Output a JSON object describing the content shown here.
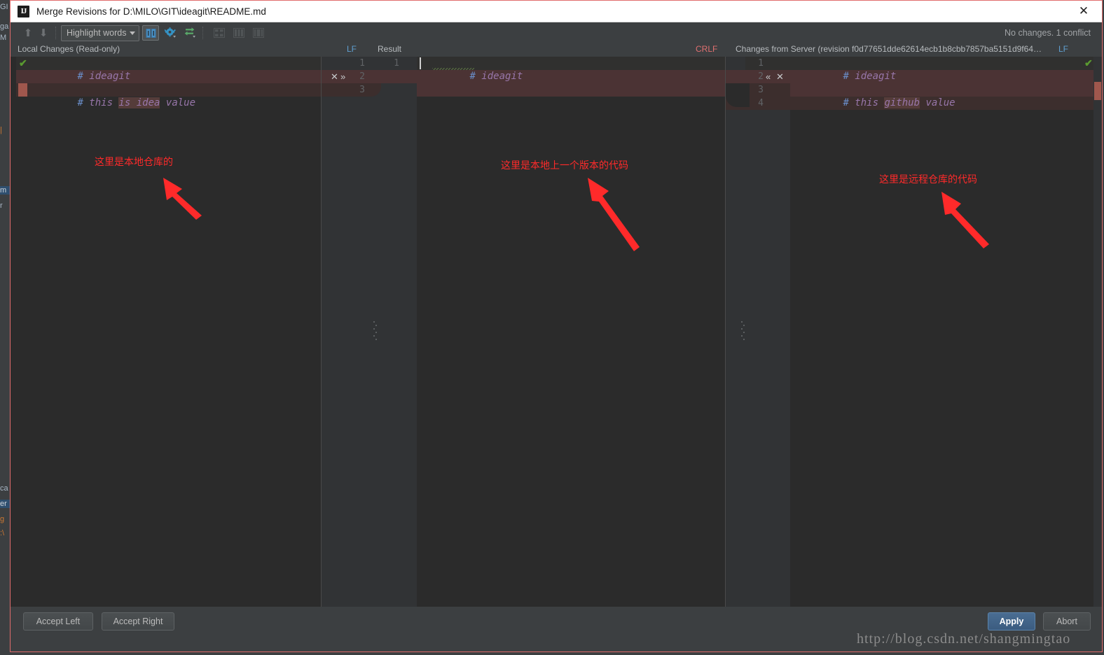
{
  "window": {
    "title": "Merge Revisions for D:\\MILO\\GIT\\ideagit\\README.md",
    "app_icon": "IJ",
    "close_icon": "✕"
  },
  "toolbar": {
    "prev_diff_icon": "⬆",
    "next_diff_icon": "⬇",
    "highlight_mode": "Highlight words",
    "caret_icon": "chevron-down-icon",
    "buttons": [
      {
        "name": "side-by-side-viewer-button",
        "state": "pressed"
      },
      {
        "name": "settings-gear-button",
        "state": "normal"
      },
      {
        "name": "compare-sync-button",
        "state": "normal"
      },
      {
        "name": "collapse-unchanged-button",
        "state": "disabled"
      },
      {
        "name": "show-whitespace-button",
        "state": "disabled"
      },
      {
        "name": "ignore-whitespace-button",
        "state": "disabled"
      }
    ],
    "status": "No changes. 1 conflict"
  },
  "panes": {
    "left": {
      "title": "Local Changes (Read-only)",
      "line_sep": "LF",
      "lines": [
        {
          "num": "1",
          "hash": "#",
          "text": " ideagit",
          "hl": ""
        },
        {
          "num": "",
          "hash": "",
          "text": "",
          "hl": ""
        },
        {
          "num": "",
          "hash": "#",
          "text": " this is idea value",
          "hl": "is idea"
        }
      ]
    },
    "center": {
      "title": "Result",
      "line_sep": "CRLF",
      "left_numbers": [
        "1",
        "2",
        "3"
      ],
      "result_numbers": [
        "1"
      ],
      "lines": [
        {
          "hash": "#",
          "text": " ideagit"
        }
      ],
      "accept_left_icon": "✕",
      "apply_right_icon": "»"
    },
    "right": {
      "title": "Changes from Server (revision f0d77651dde62614ecb1b8cbb7857ba5151d9f64…",
      "line_sep": "LF",
      "numbers": [
        "1",
        "2",
        "3",
        "4"
      ],
      "lines": [
        {
          "hash": "#",
          "text": " ideagit",
          "hl": ""
        },
        {
          "hash": "#",
          "text": " this github value",
          "hl": "github"
        }
      ],
      "apply_left_icon": "«",
      "reject_icon": "✕",
      "ok_check": "✔"
    }
  },
  "bottom": {
    "accept_left": "Accept Left",
    "accept_right": "Accept Right",
    "apply": "Apply",
    "abort": "Abort"
  },
  "watermark": "http://blog.csdn.net/shangmingtao",
  "annotations": [
    {
      "text": "这里是本地仓库的"
    },
    {
      "text": "这里是本地上一个版本的代码"
    },
    {
      "text": "这里是远程仓库的代码"
    }
  ],
  "ide_background_fragments": [
    {
      "text": "GI"
    },
    {
      "text": "ga"
    },
    {
      "text": "M"
    },
    {
      "text": "|"
    },
    {
      "text": "m"
    },
    {
      "text": "r"
    },
    {
      "text": "ca"
    },
    {
      "text": "er"
    },
    {
      "text": "g"
    },
    {
      "text": ":\\"
    }
  ],
  "colors": {
    "accent_red": "#ff2a2a",
    "conflict_band": "#4b3334",
    "changed_band": "#30302f",
    "marker_red": "#a0574d",
    "check_green": "#5a9a30",
    "keyword_blue": "#6a8ec9",
    "text_purple": "#9876aa",
    "lf_blue": "#5f9fd0",
    "crlf_red": "#e07070"
  }
}
